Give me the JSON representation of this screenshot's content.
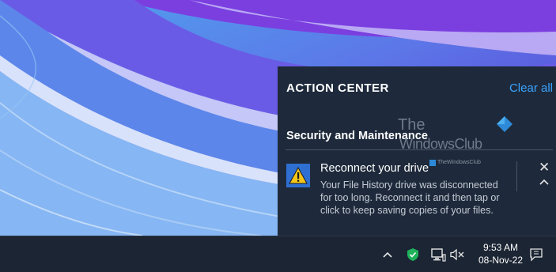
{
  "action_center": {
    "title": "ACTION CENTER",
    "clear_all": "Clear all",
    "group_title": "Security and Maintenance",
    "notification": {
      "title": "Reconnect your drive",
      "body": "Your File History drive was disconnected for too long. Reconnect it and then tap or click to keep saving copies of your files.",
      "icon": "warning-icon"
    }
  },
  "watermark": {
    "line1": "The",
    "line2": "WindowsClub",
    "small": "TheWindowsClub"
  },
  "taskbar": {
    "time": "9:53 AM",
    "date": "08-Nov-22",
    "icons": [
      "show-hidden-icons-chevron",
      "windows-security-shield-icon",
      "network-icon",
      "volume-muted-icon",
      "notification-center-icon"
    ]
  },
  "colors": {
    "accent": "#3aa3ff",
    "panel_bg": "#1e2a3b",
    "taskbar_bg": "#1b2533",
    "warning_bg": "#2f6fd1",
    "warning_yellow": "#f5c518",
    "shield_green": "#1fb25a"
  }
}
